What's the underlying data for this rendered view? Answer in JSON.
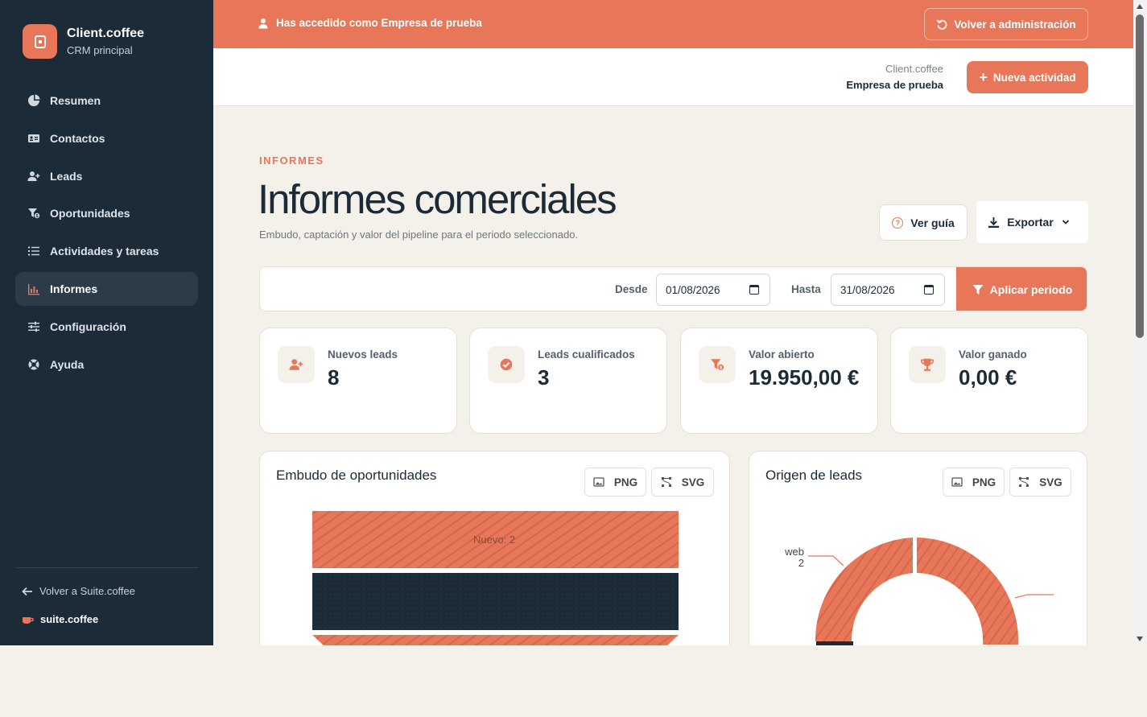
{
  "sidebar": {
    "brand_name": "Client.coffee",
    "brand_sub": "CRM principal",
    "items": [
      {
        "label": "Resumen",
        "icon": "pie-chart-icon"
      },
      {
        "label": "Contactos",
        "icon": "contact-card-icon"
      },
      {
        "label": "Leads",
        "icon": "user-plus-icon"
      },
      {
        "label": "Oportunidades",
        "icon": "funnel-dollar-icon"
      },
      {
        "label": "Actividades y tareas",
        "icon": "list-icon"
      },
      {
        "label": "Informes",
        "icon": "bar-chart-icon",
        "active": true
      },
      {
        "label": "Configuración",
        "icon": "sliders-icon"
      },
      {
        "label": "Ayuda",
        "icon": "lifebuoy-icon"
      }
    ],
    "back_label": "Volver a Suite.coffee",
    "suite_label": "suite.coffee"
  },
  "banner": {
    "message": "Has accedido como Empresa de prueba",
    "back_admin": "Volver a administración",
    "color": "#e8775a"
  },
  "header": {
    "company_app": "Client.coffee",
    "company_name": "Empresa de prueba",
    "new_activity": "Nueva actividad"
  },
  "page": {
    "eyebrow": "INFORMES",
    "title": "Informes comerciales",
    "subtitle": "Embudo, captación y valor del pipeline para el periodo seleccionado.",
    "guide_label": "Ver guía",
    "export_label": "Exportar"
  },
  "filters": {
    "from_label": "Desde",
    "from_value": "01/08/2026",
    "to_label": "Hasta",
    "to_value": "31/08/2026",
    "apply_label": "Aplicar periodo"
  },
  "kpis": [
    {
      "label": "Nuevos leads",
      "value": "8",
      "icon": "user-plus-icon"
    },
    {
      "label": "Leads cualificados",
      "value": "3",
      "icon": "check-circle-icon"
    },
    {
      "label": "Valor abierto",
      "value": "19.950,00 €",
      "icon": "funnel-dollar-icon"
    },
    {
      "label": "Valor ganado",
      "value": "0,00 €",
      "icon": "trophy-icon"
    }
  ],
  "charts": {
    "funnel_title": "Embudo de oportunidades",
    "origin_title": "Origen de leads",
    "png_label": "PNG",
    "svg_label": "SVG",
    "funnel_stage_label": "Nuevo: 2",
    "donut_label_name": "web",
    "donut_label_value": "2"
  },
  "colors": {
    "accent": "#e8775a",
    "navy": "#1b2b38",
    "background": "#f4f1eb"
  }
}
